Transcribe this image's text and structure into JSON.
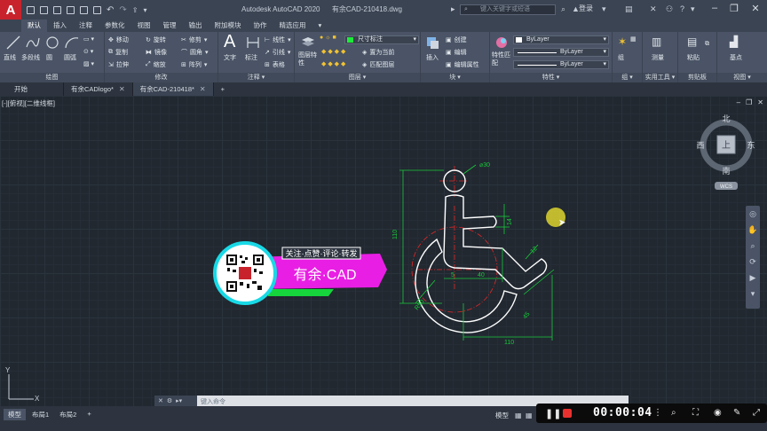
{
  "app": {
    "logo_letter": "A",
    "title": "Autodesk AutoCAD 2020",
    "document": "有余CAD-210418.dwg",
    "search_placeholder": "键入关键字或短语",
    "login": "登录"
  },
  "ribbon_tabs": [
    "默认",
    "插入",
    "注释",
    "参数化",
    "视图",
    "管理",
    "输出",
    "附加模块",
    "协作",
    "精选应用"
  ],
  "ribbon_active_tab": "默认",
  "ribbon": {
    "draw": {
      "label": "绘图",
      "buttons": [
        "直线",
        "多段线",
        "圆",
        "圆弧"
      ]
    },
    "modify": {
      "label": "修改",
      "buttons": [
        "移动",
        "旋转",
        "修剪",
        "复制",
        "镜像",
        "圆角",
        "拉伸",
        "缩放",
        "阵列"
      ]
    },
    "annotation": {
      "label": "注释",
      "buttons": [
        "文字",
        "标注",
        "线性",
        "引线",
        "表格"
      ]
    },
    "layers": {
      "label": "图层",
      "layer_props": "图层特性",
      "current_layer": "尺寸标注",
      "buttons": [
        "置为当前",
        "匹配图层"
      ]
    },
    "block": {
      "label": "块",
      "buttons": [
        "插入",
        "创建",
        "编辑",
        "编辑属性"
      ]
    },
    "properties": {
      "label": "特性",
      "match": "特性匹配",
      "color": "ByLayer",
      "linetype": "ByLayer",
      "lineweight": "ByLayer"
    },
    "groups": {
      "label": "组",
      "button": "组"
    },
    "utilities": {
      "label": "实用工具",
      "button": "测量"
    },
    "clipboard": {
      "label": "剪贴板",
      "button": "粘贴"
    },
    "view": {
      "label": "视图",
      "button": "基点"
    }
  },
  "file_tabs": [
    {
      "label": "开始",
      "closable": false,
      "active": false
    },
    {
      "label": "有余CADlogo*",
      "closable": true,
      "active": false
    },
    {
      "label": "有余CAD-210418*",
      "closable": true,
      "active": true
    }
  ],
  "viewport": {
    "label": "[-][俯视][二维线框]"
  },
  "viewcube": {
    "north": "北",
    "south": "南",
    "east": "东",
    "west": "西",
    "top": "上",
    "wcs": "WCS"
  },
  "badge": {
    "caption": "关注·点赞·评论·转发",
    "brand": "有余·CAD"
  },
  "dimensions": {
    "head_dia": "⌀30",
    "height": "110",
    "arm": "14",
    "d5": "5",
    "d40": "40",
    "d45": "45",
    "arc_r": "R50",
    "d12": "12",
    "bottom": "110"
  },
  "ucs": {
    "x": "X",
    "y": "Y"
  },
  "command": {
    "placeholder": "键入命令"
  },
  "layout_tabs": [
    {
      "label": "模型",
      "active": true
    },
    {
      "label": "布局1",
      "active": false
    },
    {
      "label": "布局2",
      "active": false
    }
  ],
  "status": {
    "model": "模型"
  },
  "recorder": {
    "time": "00:00:04"
  },
  "colors": {
    "accent_pink": "#e91ee4",
    "accent_cyan": "#19d9e6",
    "green_line": "#16d43c",
    "layer_green": "#1eea3a"
  }
}
